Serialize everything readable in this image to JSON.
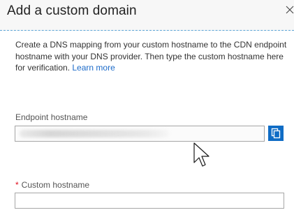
{
  "dialog": {
    "title": "Add a custom domain",
    "intro_text": "Create a DNS mapping from your custom hostname to the CDN endpoint hostname with your DNS provider. Then type the custom hostname here for verification.",
    "learn_more_label": "Learn more"
  },
  "endpoint": {
    "label": "Endpoint hostname",
    "value_redacted": true
  },
  "custom_hostname": {
    "required_marker": "*",
    "label": "Custom hostname",
    "value": ""
  },
  "colors": {
    "accent": "#0f6cc5",
    "link": "#1b6ac9",
    "required": "#e00b1c",
    "divider": "#5ba4d6"
  },
  "icons": {
    "close": "close-icon",
    "copy": "copy-icon",
    "cursor": "mouse-pointer-icon"
  }
}
